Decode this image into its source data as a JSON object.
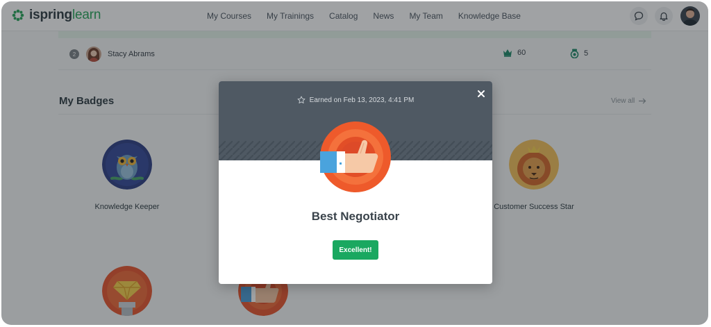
{
  "header": {
    "logo_text_main": "ispring",
    "logo_text_accent": "learn",
    "nav": [
      "My Courses",
      "My Trainings",
      "Catalog",
      "News",
      "My Team",
      "Knowledge Base"
    ],
    "icons": [
      "chat-icon",
      "bell-icon"
    ]
  },
  "leaderboard": {
    "rank": "2",
    "name": "Stacy Abrams",
    "points": "60",
    "badges": "5"
  },
  "badges_section": {
    "title": "My Badges",
    "view_all": "View all",
    "items": [
      {
        "label": "Knowledge Keeper",
        "icon": "owl-icon"
      },
      {
        "label": "Customer Success Star",
        "icon": "lion-icon"
      },
      {
        "label": "",
        "icon": "diamond-icon"
      },
      {
        "label": "",
        "icon": "thumbs-up-icon"
      }
    ]
  },
  "modal": {
    "earned": "Earned on Feb 13, 2023, 4:41 PM",
    "badge_title": "Best Negotiator",
    "button": "Excellent!"
  },
  "colors": {
    "brand_green": "#27a55a",
    "button_green": "#1aa860",
    "modal_header": "#4f5963",
    "badge_orange": "#f0572a"
  }
}
